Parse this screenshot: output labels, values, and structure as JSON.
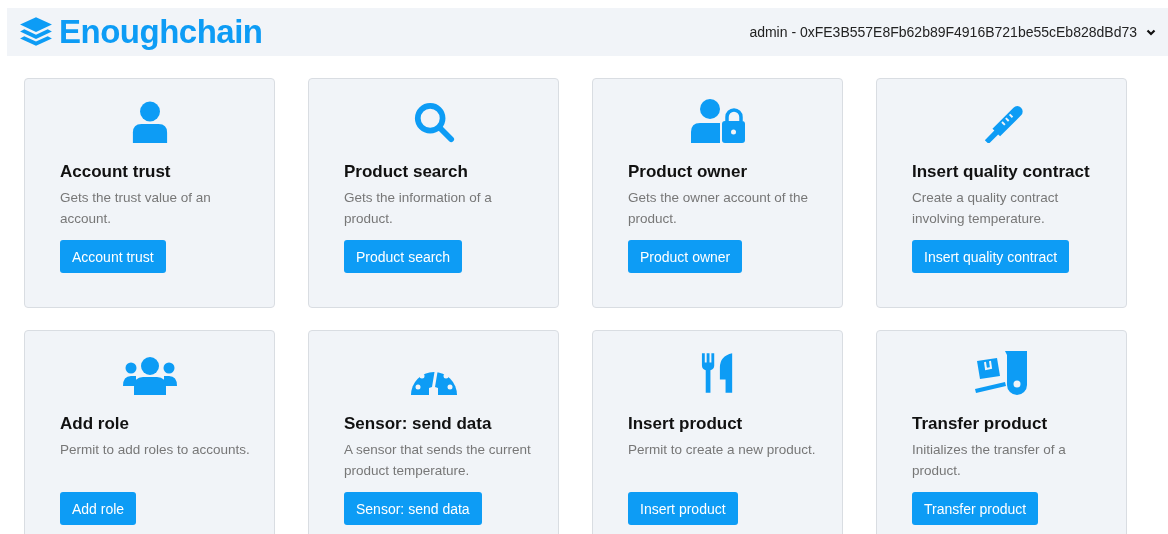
{
  "brand": {
    "name": "Enoughchain"
  },
  "account": {
    "label": "admin - 0xFE3B557E8Fb62b89F4916B721be55cEb828dBd73"
  },
  "cards": [
    {
      "title": "Account trust",
      "description": "Gets the trust value of an account.",
      "button": "Account trust"
    },
    {
      "title": "Product search",
      "description": "Gets the information of a product.",
      "button": "Product search"
    },
    {
      "title": "Product owner",
      "description": "Gets the owner account of the product.",
      "button": "Product owner"
    },
    {
      "title": "Insert quality contract",
      "description": "Create a quality contract involving temperature.",
      "button": "Insert quality contract"
    },
    {
      "title": "Add role",
      "description": "Permit to add roles to accounts.",
      "button": "Add role"
    },
    {
      "title": "Sensor: send data",
      "description": "A sensor that sends the current product temperature.",
      "button": "Sensor: send data"
    },
    {
      "title": "Insert product",
      "description": "Permit to create a new product.",
      "button": "Insert product"
    },
    {
      "title": "Transfer product",
      "description": "Initializes the transfer of a product.",
      "button": "Transfer product"
    }
  ]
}
